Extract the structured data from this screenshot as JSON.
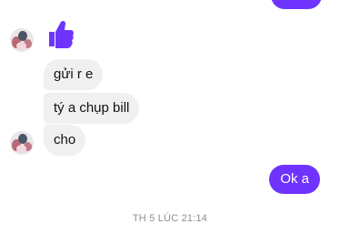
{
  "conversation": {
    "incoming": [
      {
        "text": "gửi r e"
      },
      {
        "text": "tý a chụp bill"
      },
      {
        "text": "cho"
      }
    ],
    "outgoing": [
      {
        "text": "Ok a"
      }
    ],
    "timestamp": "TH 5 LÚC 21:14",
    "reaction_icon": "thumbs-up-icon"
  },
  "colors": {
    "accent": "#6e33ff",
    "incoming_bubble": "#f1f0f0",
    "timestamp_text": "#8f8f8f"
  }
}
